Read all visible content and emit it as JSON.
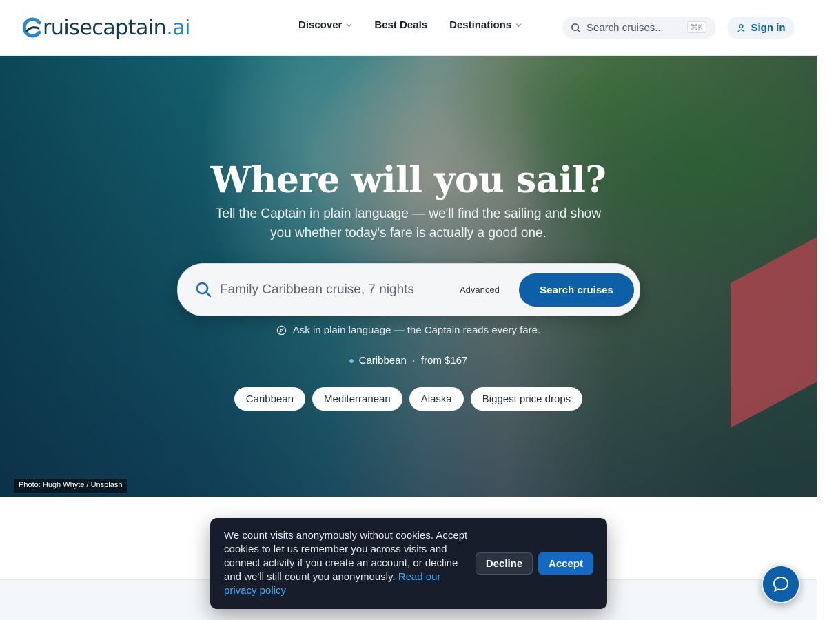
{
  "brand": {
    "logo_main": "ruisecaptain",
    "logo_suffix": ".ai",
    "logo_icon": "c-swoosh-logo-icon"
  },
  "nav": {
    "discover": "Discover",
    "best_deals": "Best Deals",
    "destinations": "Destinations"
  },
  "header_search": {
    "placeholder": "Search cruises...",
    "shortcut": "⌘K"
  },
  "signin": {
    "label": "Sign in",
    "icon": "user-icon"
  },
  "hero": {
    "title": "Where will you sail?",
    "subtitle": "Tell the Captain in plain language — we'll find the sailing and show you whether today's fare is actually a good one.",
    "search_placeholder": "Family Caribbean cruise, 7 nights",
    "advanced": "Advanced",
    "search_button": "Search cruises",
    "hint": "Ask in plain language — the Captain reads every fare.",
    "meta_region": "Caribbean",
    "meta_sep": "·",
    "meta_price": "from $167",
    "chips": [
      "Caribbean",
      "Mediterranean",
      "Alaska",
      "Biggest price drops"
    ]
  },
  "photo_credit": {
    "prefix": "Photo:",
    "author": "Hugh Whyte",
    "sep": "/",
    "source": "Unsplash"
  },
  "cookie": {
    "text": "We count visits anonymously without cookies. Accept cookies to let us remember you across visits and connect activity if you create an account, or decline and we'll still count you anonymously.",
    "link": "Read our privacy policy",
    "decline": "Decline",
    "accept": "Accept"
  },
  "colors": {
    "primary": "#0d5fa8",
    "cookie_bg": "#171d2a",
    "link": "#4fa7ee"
  }
}
